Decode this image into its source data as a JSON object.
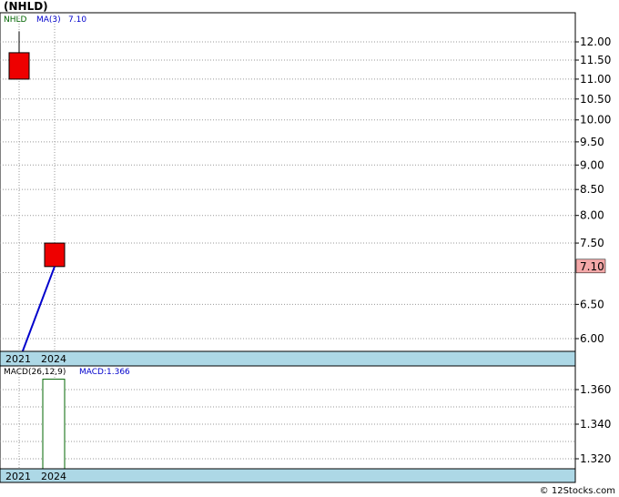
{
  "title": "(NHLD)",
  "watermark": "© 12Stocks.com",
  "colors": {
    "up": "#ee0000",
    "ma": "#0000cc",
    "macd_bar": "#006400",
    "axis_band": "#add8e6",
    "last_bg": "#f4a8a8",
    "legend_name": "#006400",
    "legend_ma": "#0000cc"
  },
  "chart_data": [
    {
      "type": "candlestick",
      "panel": "price",
      "legend": {
        "symbol": "NHLD",
        "ma_label": "MA(3)",
        "ma_value": "7.10"
      },
      "categories": [
        "2021",
        "2024"
      ],
      "ohlc": [
        {
          "x": "2021",
          "open": 11.0,
          "high": 12.3,
          "low": 11.0,
          "close": 11.7
        },
        {
          "x": "2024",
          "open": 7.1,
          "high": 7.5,
          "low": 7.1,
          "close": 7.5
        }
      ],
      "ma": {
        "name": "MA(3)",
        "points": [
          {
            "x": "2021",
            "y": 5.7
          },
          {
            "x": "2024",
            "y": 7.1
          }
        ]
      },
      "last_price_label": "7.10",
      "last_price": 7.1,
      "y_ticks": [
        "12.00",
        "11.50",
        "11.00",
        "10.50",
        "10.00",
        "9.50",
        "9.00",
        "8.50",
        "8.00",
        "7.50",
        "6.50",
        "6.00"
      ],
      "grid": true,
      "y_scale": "log"
    },
    {
      "type": "bar",
      "panel": "macd",
      "legend": {
        "name": "MACD(26,12,9)",
        "value_label": "MACD:1.366"
      },
      "categories": [
        "2021",
        "2024"
      ],
      "values": [
        null,
        1.366
      ],
      "y_ticks": [
        "1.360",
        "1.340",
        "1.320"
      ],
      "ylim": [
        1.309,
        1.372
      ],
      "grid": true
    }
  ]
}
